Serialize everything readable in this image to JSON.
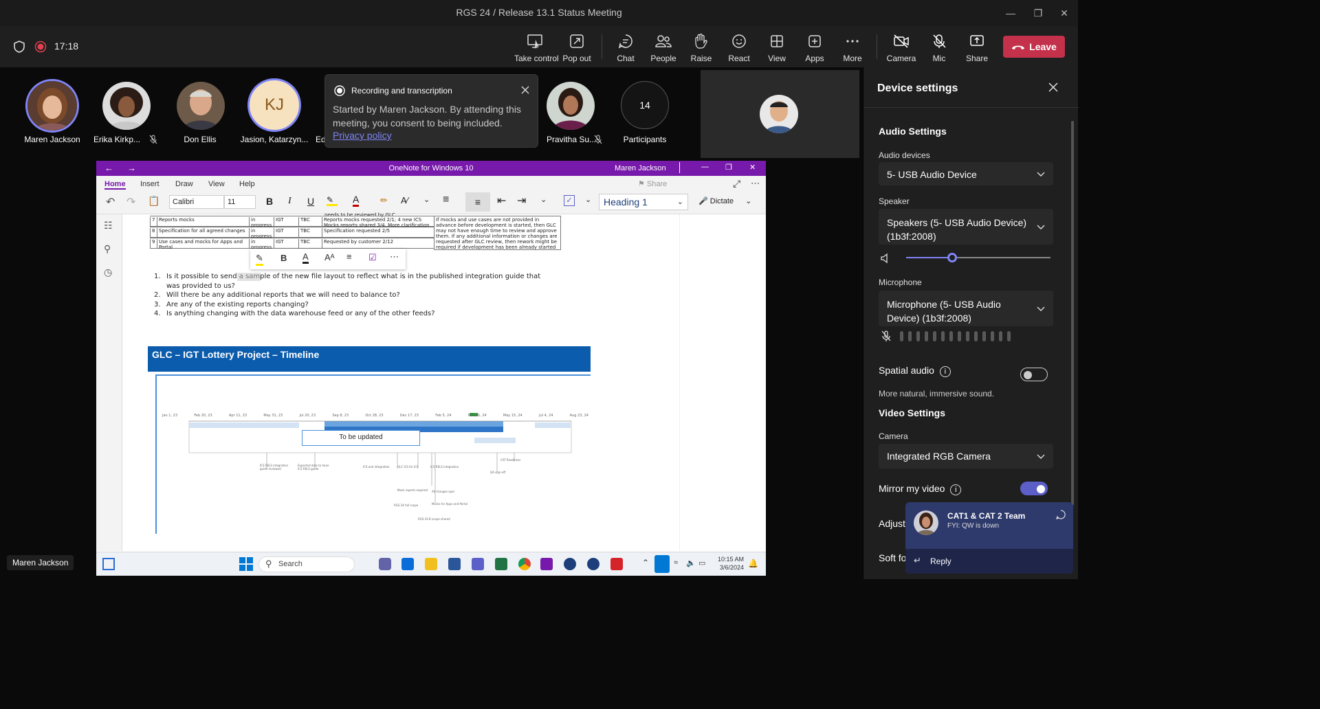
{
  "window": {
    "title": "RGS 24 / Release 13.1 Status Meeting"
  },
  "meeting": {
    "elapsed": "17:18",
    "toolbar": {
      "take_control": "Take control",
      "pop_out": "Pop out",
      "chat": "Chat",
      "people": "People",
      "raise": "Raise",
      "react": "React",
      "view": "View",
      "apps": "Apps",
      "more": "More",
      "camera": "Camera",
      "mic": "Mic",
      "share": "Share",
      "leave": "Leave"
    },
    "participants": [
      {
        "name": "Maren Jackson"
      },
      {
        "name": "Erika Kirkp..."
      },
      {
        "name": "Don Ellis"
      },
      {
        "name": "Jasion, Katarzyn...",
        "initials": "KJ"
      },
      {
        "name": "Ed"
      },
      {
        "name": "Pravitha Su..."
      },
      {
        "name": "Participants",
        "count": "14"
      }
    ],
    "recording_popup": {
      "title": "Recording and transcription",
      "body": "Started by Maren Jackson. By attending this meeting, you consent to being included.",
      "link": "Privacy policy"
    },
    "presenter_badge": "Maren Jackson"
  },
  "onenote": {
    "title": "OneNote for Windows 10",
    "user": "Maren Jackson",
    "tabs": [
      "Home",
      "Insert",
      "Draw",
      "View",
      "Help"
    ],
    "share_label": "Share",
    "font": "Calibri",
    "font_size": "11",
    "style": "Heading 1",
    "dictate": "Dictate",
    "table_rows": [
      {
        "num": "7",
        "item": "Reports mocks",
        "status": "in progress",
        "owner": "IGT",
        "date": "TBC",
        "notes": "Reports mocks requested 2/1; 4 new ICS Mocks reports shared 3/4. More clarification requested"
      },
      {
        "num": "8",
        "item": "Specification for all agreed changes",
        "status": "in progress",
        "owner": "IGT",
        "date": "TBC",
        "notes": "Specification requested 2/5"
      },
      {
        "num": "9",
        "item": "Use cases and mocks for Apps and Portal",
        "status": "in progress",
        "owner": "IGT",
        "date": "TBC",
        "notes": "Requested by customer 2/12"
      }
    ],
    "table_header_fragment": "needs to be reviewed by GLC",
    "table_note": "If mocks and use cases are not provided in advance before development is started, then GLC may not have enough time to review and approve them. If any additional information or changes are requested after GLC review, then rework might be required if development has been already started what may impact project timeline.",
    "questions": [
      "Is it possible to send a sample of the new file layout to reflect what is in the published integration guide that was provided to us?",
      "Will there be any additional reports that we will need to balance to?",
      "Are any of the existing reports changing?",
      "Is anything changing with the data warehouse feed or any of the other feeds?"
    ],
    "banner": "GLC – IGT Lottery Project – Timeline",
    "timeline_box": "To be updated",
    "timeline_today": "Today",
    "timeline_dates": [
      "Jan 1, 23",
      "Feb 20, 23",
      "Apr 11, 23",
      "May 31, 23",
      "Jul 20, 23",
      "Sep 8, 23",
      "Oct 28, 23",
      "Dec 17, 23",
      "Feb 5, 24",
      "Mar 26, 24",
      "May 15, 24",
      "Jul 4, 24",
      "Aug 23, 24"
    ]
  },
  "taskbar": {
    "search": "Search",
    "time": "10:15 AM",
    "date": "3/6/2024"
  },
  "device_settings": {
    "title": "Device settings",
    "audio_settings": "Audio Settings",
    "audio_devices_label": "Audio devices",
    "audio_device": "5- USB Audio Device",
    "speaker_label": "Speaker",
    "speaker": "Speakers (5- USB Audio Device) (1b3f:2008)",
    "speaker_volume": 0.32,
    "microphone_label": "Microphone",
    "microphone": "Microphone (5- USB Audio Device) (1b3f:2008)",
    "spatial_audio": "Spatial audio",
    "spatial_desc": "More natural, immersive sound.",
    "spatial_on": false,
    "video_settings": "Video Settings",
    "camera_label": "Camera",
    "camera": "Integrated RGB Camera",
    "mirror": "Mirror my video",
    "mirror_on": true,
    "adjust": "Adjust",
    "soft_focus": "Soft fo"
  },
  "notification": {
    "team": "CAT1 & CAT 2 Team",
    "message": "FYI: QW is down",
    "reply": "Reply"
  },
  "colors": {
    "leave": "#c4314b",
    "accent": "#5b5fc7",
    "onenote": "#7719aa",
    "banner": "#0b5cad"
  }
}
